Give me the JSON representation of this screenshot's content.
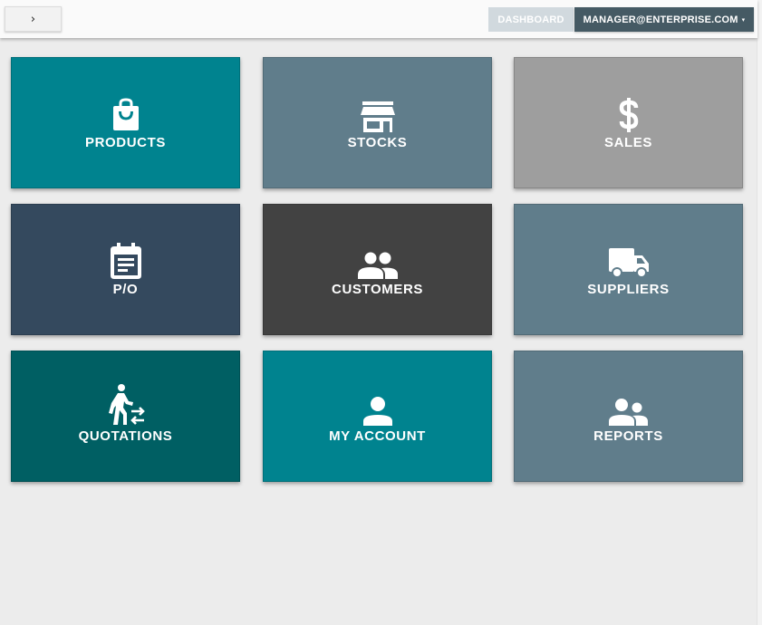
{
  "topbar": {
    "toggle_label": "›",
    "dashboard_label": "DASHBOARD",
    "user_label": "MANAGER@ENTERPRISE.COM",
    "user_caret": "▾"
  },
  "tiles": [
    {
      "label": "PRODUCTS",
      "icon": "shopping-bag-icon",
      "color": "#00838f"
    },
    {
      "label": "STOCKS",
      "icon": "store-icon",
      "color": "#607d8b"
    },
    {
      "label": "SALES",
      "icon": "dollar-icon",
      "color": "#9e9e9e"
    },
    {
      "label": "P/O",
      "icon": "calendar-note-icon",
      "color": "#34495e"
    },
    {
      "label": "CUSTOMERS",
      "icon": "people-icon",
      "color": "#424242"
    },
    {
      "label": "SUPPLIERS",
      "icon": "truck-icon",
      "color": "#607d8b"
    },
    {
      "label": "QUOTATIONS",
      "icon": "walker-exchange-icon",
      "color": "#005f63"
    },
    {
      "label": "MY ACCOUNT",
      "icon": "person-icon",
      "color": "#00838f"
    },
    {
      "label": "REPORTS",
      "icon": "supervisor-icon",
      "color": "#607d8b"
    }
  ]
}
